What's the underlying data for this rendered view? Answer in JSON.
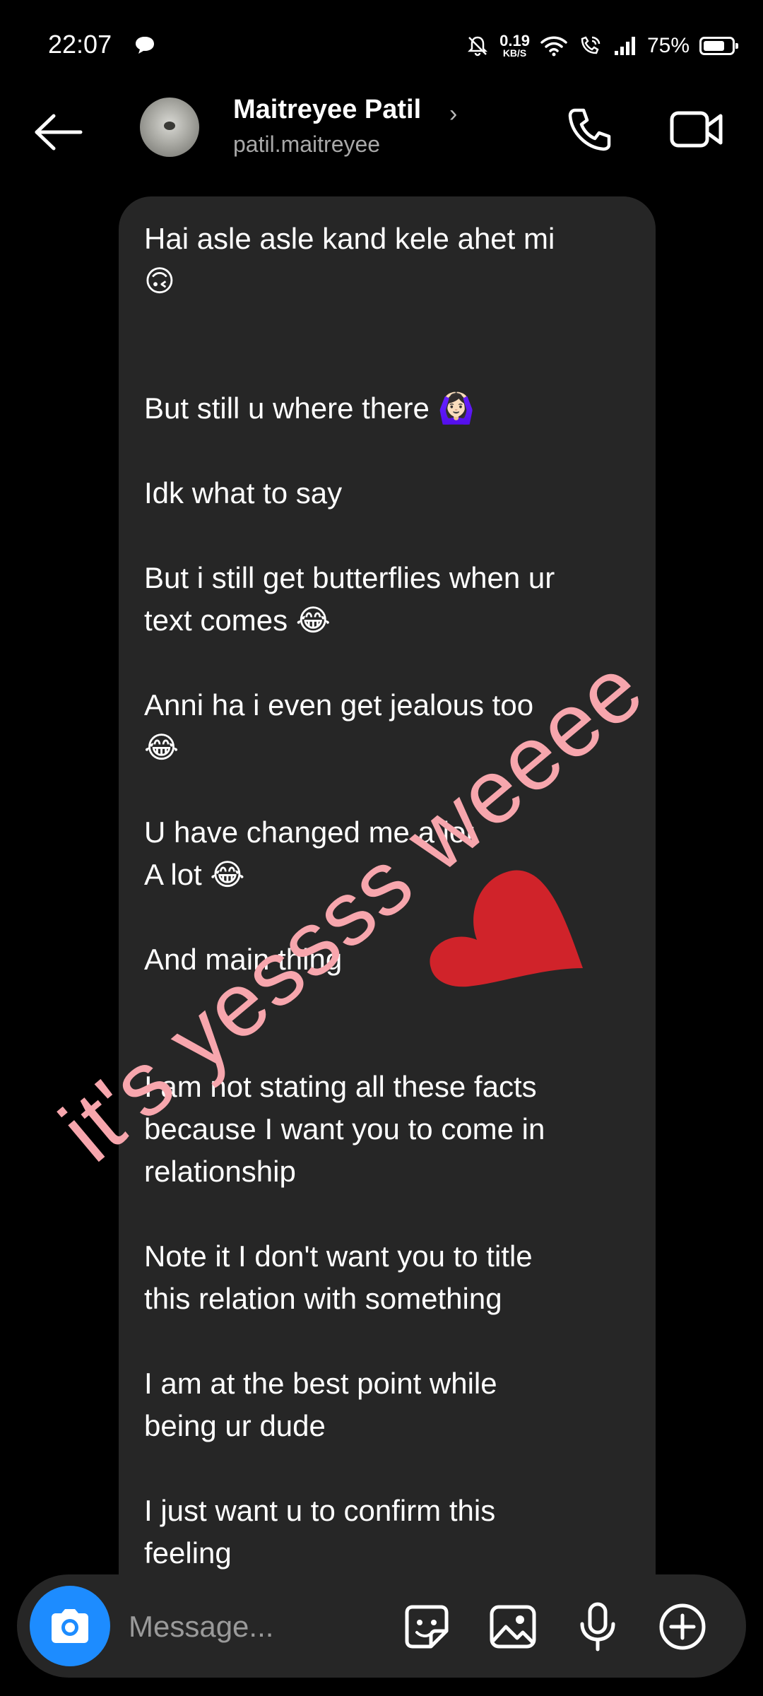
{
  "status_bar": {
    "time": "22:07",
    "net_speed_value": "0.19",
    "net_speed_unit": "KB/S",
    "battery_percent": "75%",
    "battery_level": 0.75,
    "icons": [
      "chat-bubble-icon",
      "mute-bell-icon",
      "wifi-icon",
      "wifi-calling-icon",
      "signal-icon",
      "battery-icon"
    ]
  },
  "header": {
    "contact_name": "Maitreyee Patil",
    "contact_handle": "patil.maitreyee",
    "back_icon": "arrow-left-icon",
    "call_icon": "phone-icon",
    "video_icon": "video-camera-icon"
  },
  "message": {
    "text": "Hai asle asle kand kele ahet mi\n🙃\n\n\nBut still u where there 🙆🏻‍♀️\n\nIdk what to say\n\nBut i still get butterflies when ur\ntext comes 😂\n\nAnni ha i even get jealous too\n😂\n\nU have changed me a lot\nA lot 😂\n\nAnd main thing\n\n\nI am not stating all these facts\nbecause I want you to come in\nrelationship\n\nNote it I don't want you to title\nthis relation with something\n\nI am at the best point while\nbeing ur dude\n\nI just want u to confirm this\nfeeling"
  },
  "overlay": {
    "handwritten_text": "it's yessss weeee",
    "heart_color": "#d0232a",
    "text_color": "#f7a6ad"
  },
  "composer": {
    "placeholder": "Message...",
    "icons": [
      "camera-icon",
      "sticker-icon",
      "gallery-icon",
      "microphone-icon",
      "plus-circle-icon"
    ],
    "accent": "#1d8cff"
  }
}
